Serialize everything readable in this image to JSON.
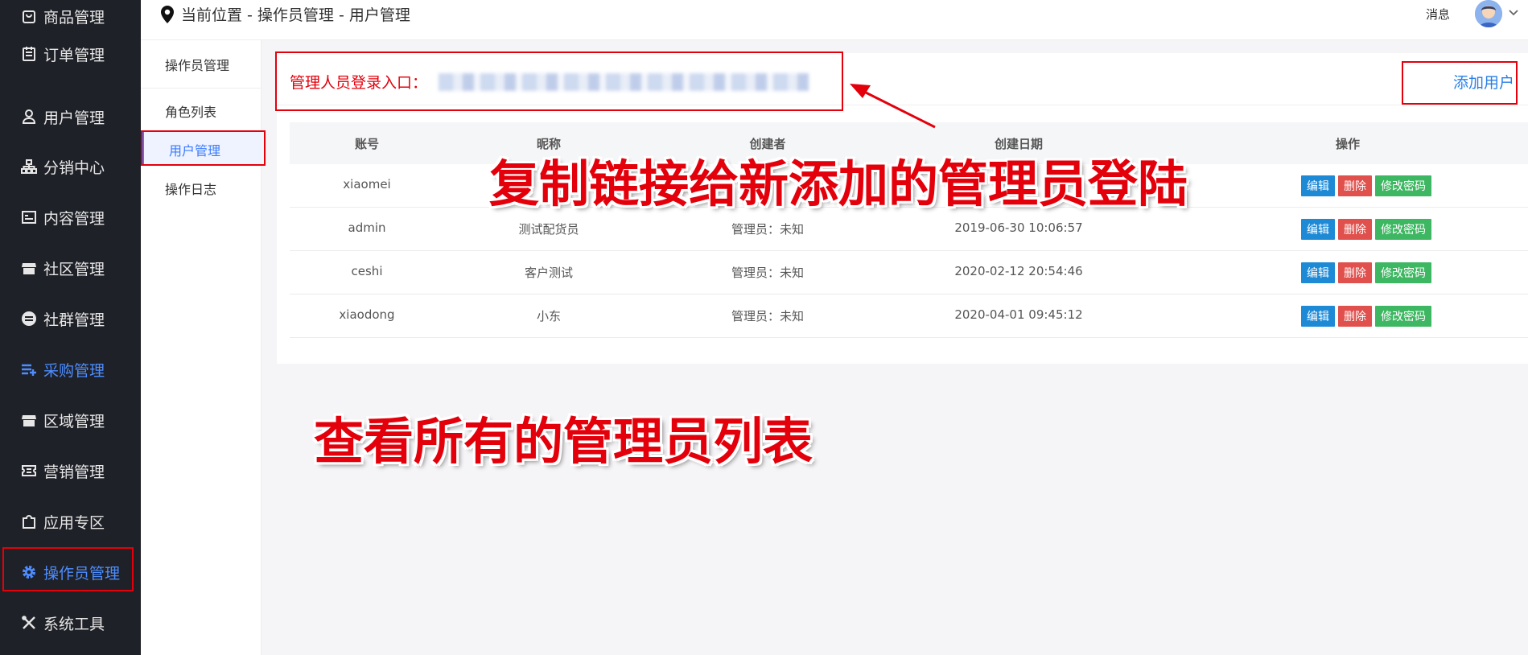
{
  "sidebar": {
    "items": [
      {
        "label": "商品管理",
        "icon": "bag-icon"
      },
      {
        "label": "订单管理",
        "icon": "clipboard-icon"
      },
      {
        "label": "用户管理",
        "icon": "user-icon"
      },
      {
        "label": "分销中心",
        "icon": "org-chart-icon"
      },
      {
        "label": "内容管理",
        "icon": "content-icon"
      },
      {
        "label": "社区管理",
        "icon": "store-icon"
      },
      {
        "label": "社群管理",
        "icon": "minus-circle-icon"
      },
      {
        "label": "采购管理",
        "icon": "list-add-icon"
      },
      {
        "label": "区域管理",
        "icon": "shop-icon"
      },
      {
        "label": "营销管理",
        "icon": "ticket-icon"
      },
      {
        "label": "应用专区",
        "icon": "puzzle-icon"
      },
      {
        "label": "操作员管理",
        "icon": "gear-icon"
      },
      {
        "label": "系统工具",
        "icon": "tools-icon"
      }
    ]
  },
  "header": {
    "breadcrumb": "当前位置 - 操作员管理 - 用户管理",
    "messages": "消息"
  },
  "subnav": {
    "title": "操作员管理",
    "items": [
      "角色列表",
      "用户管理",
      "操作日志"
    ]
  },
  "main": {
    "login_label": "管理人员登录入口：",
    "add_user": "添加用户",
    "columns": [
      "账号",
      "昵称",
      "创建者",
      "创建日期",
      "操作"
    ],
    "rows": [
      {
        "account": "xiaomei",
        "nickname": "",
        "creator": "",
        "date": ""
      },
      {
        "account": "admin",
        "nickname": "测试配货员",
        "creator": "管理员：未知",
        "date": "2019-06-30 10:06:57"
      },
      {
        "account": "ceshi",
        "nickname": "客户测试",
        "creator": "管理员：未知",
        "date": "2020-02-12 20:54:46"
      },
      {
        "account": "xiaodong",
        "nickname": "小东",
        "creator": "管理员：未知",
        "date": "2020-04-01 09:45:12"
      }
    ],
    "actions": {
      "edit": "编辑",
      "delete": "删除",
      "change_password": "修改密码"
    }
  },
  "annotations": {
    "copy_link": "复制链接给新添加的管理员登陆",
    "view_all": "查看所有的管理员列表",
    "color": "#e3000b"
  }
}
